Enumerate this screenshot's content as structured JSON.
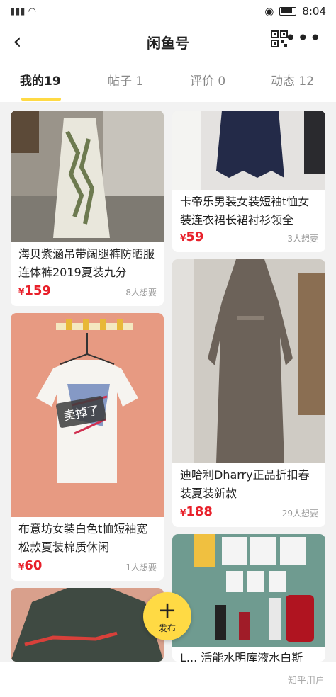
{
  "status": {
    "left_icons": "signal wifi",
    "time": "8:04"
  },
  "nav": {
    "title": "闲鱼号"
  },
  "tabs": [
    {
      "label": "我的19"
    },
    {
      "label": "帖子 1"
    },
    {
      "label": "评价 0"
    },
    {
      "label": "动态 12"
    }
  ],
  "cards": [
    {
      "title": "海贝紫涵吊带阔腿裤防晒服连体裤2019夏装九分",
      "price": "159",
      "wants": "8人想要"
    },
    {
      "title": "卡帝乐男装女装短袖t恤女装连衣裙长裙衬衫领全",
      "price": "59",
      "wants": "3人想要"
    },
    {
      "title": "布意坊女装白色t恤短袖宽松款夏装棉质休闲",
      "price": "60",
      "wants": "1人想要",
      "badge": "卖掉了"
    },
    {
      "title": "迪哈利Dharry正品折扣春装夏装新款",
      "price": "188",
      "wants": "29人想要"
    },
    {
      "title": "L... 活能水明库液水白斯"
    }
  ],
  "fab": {
    "label": "发布"
  },
  "watermark": "知乎用户",
  "currency": "¥"
}
